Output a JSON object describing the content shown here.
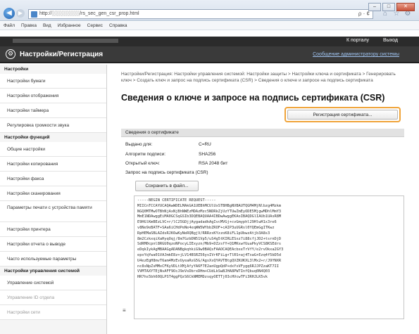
{
  "browser": {
    "address": "http://░░░░░░░░/rs_sec_gen_csr_prop.html",
    "tools": "ρ · ¢",
    "menu": [
      "Файл",
      "Правка",
      "Вид",
      "Избранное",
      "Сервис",
      "Справка"
    ]
  },
  "header": {
    "portal": "К порталу",
    "logout": "Выход",
    "title": "Настройки/Регистрация",
    "admin_link": "Сообщение администратору системы"
  },
  "sidebar": {
    "section1": "Настройки",
    "items1": [
      "Настройки бумаги",
      "Настройки отображения",
      "Настройки таймера",
      "Регулировка громкости звука"
    ],
    "section2": "Настройки функций",
    "items2": [
      "Общие настройки",
      "Настройки копирования",
      "Настройки факса",
      "Настройки сканирования",
      "Параметры печати с устройства памяти",
      "Настройки принтера",
      "Настройки отчета о выводе",
      "Часто используемые параметры"
    ],
    "section3": "Настройки управления системой",
    "items3": [
      "Управление системой",
      "Управление ID отдела",
      "Настройки сети"
    ]
  },
  "main": {
    "breadcrumb": "Настройки/Регистрация: Настройки управления системой: Настройки защиты > Настройки ключа и сертификата > Генерировать ключ > Создать ключ и запрос на подпись сертификата (CSR) > Сведения о ключе и запросе на подпись сертификата",
    "title": "Сведения о ключе и запросе на подпись сертификата (CSR)",
    "register_button": "Регистрация сертификата...",
    "cert_section": "Сведения о сертификате",
    "fields": [
      {
        "label": "Выдано для:",
        "value": "C=RU"
      },
      {
        "label": "Алгоритм подписи:",
        "value": "SHA256"
      },
      {
        "label": "Открытый ключ:",
        "value": "RSA 2048 бит"
      }
    ],
    "csr_heading": "Запрос на подпись сертификата (CSR)",
    "save_button": "Сохранить в файл...",
    "csr_text": "-----BEGIN CERTIFICATE REQUEST-----\nMIICnTCCAYUCAQAwWDELMAkGA1UEBhMCUlUxSTBHBgNVBAUTQGM4MjNlbzg4Mzkm\nNGQ0MTMwOTBhNjAxNjBhNWEzMDAzMzc5NDRkZjUzYTUwZmEyODE5MjgwMDhlMmY3\nMmE1NDAwggEiMA0GCSqGSIb3DQEBAQUAA4IBDwAwggEKAoIBAQDGlIAUb1UAsR8M\nE9HGlKmBEzLVC+r/lC25GDjjAygadadkAgIvcMVGj+cvGmyphl29HlwH1x3re6\nv8Ne9eBATF+SAa6iCHdPeNe4eqWW5WYbbZROF+cAIP3uUGRsl0YQEmGgITKwz\nRpHEMaSBLAZdsRJK6wKyNeRQBgjV/RRRzxKYzzoK8iFL1pUbwzAtjb3A8s3\n8m2CzkxqiXaHyqOqj/8m7GzbDN51Vp5/uS4g5tKIRLESxz7i88cfjJD2+tsrnDjD\nSdRM0cpnl8RGU0qzoNPocyLIExyzn/Mb9+DZzsfY+Q1MKxwfUuaPkyVCS8KSEdrs\neDqkIykAgMBAAGgADANBgkqhkiG9w0BAQsFAAOCAQEAcbxeTrVfY/e2rvOkxa2GY3\nepxYqYwa01VAJmkE8z+jLV14BSRZ56ysIVrKFiLg+TlRS+aj4TxaG+Ezq4f5bD5d\nU4ezEgH8mvT6am4MzEvUyeaRsG5G/AgsXsQYAVTBtgQVZKUKXL3lMx2+r/J9YNXR\nnc8sNpZsMMxCFKyVDLtXMjAfyYA6F7E2anUgpQdP+dxYxVFygq6RJJPZzaKT7II\nVVMTAXYTEjNvAFF9OcJ9eVsDbrxDHm+CUdLkSwBJHA8PW7InfQbuq0N4Q03\nHR7hs5bh60QLPST4ggPQzS6CkNMEMDzsqyOETTj03cHVcwTFi3RHJLK5vk"
  }
}
